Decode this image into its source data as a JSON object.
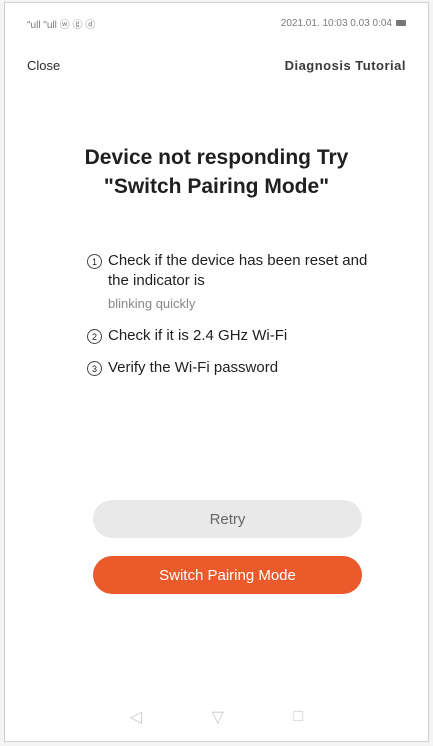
{
  "status_bar": {
    "left": "\"ull \"ull ⓦ ⓖ ⓓ",
    "right": "2021.01. 10:03 0.03 0:04"
  },
  "nav": {
    "close": "Close",
    "help": "Diagnosis Tutorial"
  },
  "title": "Device not responding Try \"Switch Pairing Mode\"",
  "tips": [
    {
      "num": "1",
      "text": "Check if the device has been reset and the indicator is",
      "sub": "blinking quickly"
    },
    {
      "num": "2",
      "text": "Check if it is 2.4 GHz Wi-Fi",
      "sub": ""
    },
    {
      "num": "3",
      "text": "Verify the Wi-Fi password",
      "sub": ""
    }
  ],
  "buttons": {
    "retry": "Retry",
    "switch_mode": "Switch Pairing Mode"
  },
  "footer_note": "",
  "system_nav": {
    "back": "◁",
    "home": "▽",
    "recent": "□"
  },
  "colors": {
    "accent": "#ea5a2a",
    "retry_bg": "#e9e9e9"
  }
}
